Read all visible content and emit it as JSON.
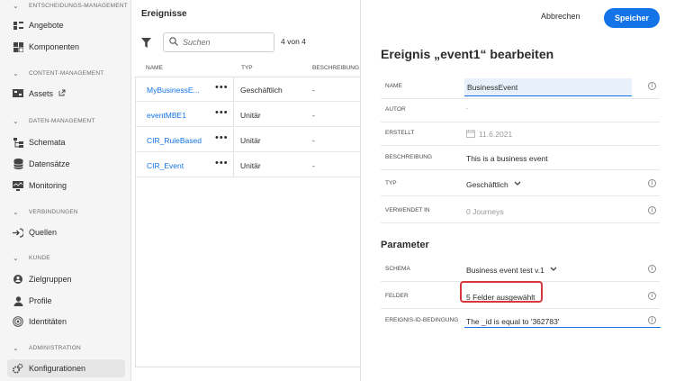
{
  "sidebar": {
    "sections": [
      {
        "label": "ENTSCHEIDUNGS-MANAGEMENT"
      },
      {
        "label": "CONTENT-MANAGEMENT"
      },
      {
        "label": "DATEN-MANAGEMENT"
      },
      {
        "label": "VERBINDUNGEN"
      },
      {
        "label": "KUNDE"
      },
      {
        "label": "ADMINISTRATION"
      }
    ],
    "items": [
      {
        "label": "Angebote",
        "icon": "offers-icon"
      },
      {
        "label": "Komponenten",
        "icon": "components-icon"
      },
      {
        "label": "Assets",
        "icon": "assets-icon"
      },
      {
        "label": "Schemata",
        "icon": "schema-icon"
      },
      {
        "label": "Datensätze",
        "icon": "datasets-icon"
      },
      {
        "label": "Monitoring",
        "icon": "monitoring-icon"
      },
      {
        "label": "Quellen",
        "icon": "sources-icon"
      },
      {
        "label": "Zielgruppen",
        "icon": "audiences-icon"
      },
      {
        "label": "Profile",
        "icon": "profile-icon"
      },
      {
        "label": "Identitäten",
        "icon": "identity-icon"
      },
      {
        "label": "Konfigurationen",
        "icon": "gears-icon"
      }
    ]
  },
  "events": {
    "title": "Ereignisse",
    "search_placeholder": "Suchen",
    "count": "4 von 4",
    "columns": {
      "name": "NAME",
      "type": "TYP",
      "description": "BESCHREIBUNG"
    },
    "rows": [
      {
        "name": "MyBusinessE...",
        "type": "Geschäftlich",
        "description": "-"
      },
      {
        "name": "eventMBE1",
        "type": "Unitär",
        "description": "-"
      },
      {
        "name": "CIR_RuleBased",
        "type": "Unitär",
        "description": "-"
      },
      {
        "name": "CIR_Event",
        "type": "Unitär",
        "description": "-"
      }
    ]
  },
  "editor": {
    "cancel_label": "Abbrechen",
    "save_label": "Speicher",
    "title": "Ereignis „event1“ bearbeiten",
    "fields": {
      "name": {
        "label": "NAME",
        "value": "BusinessEvent"
      },
      "author": {
        "label": "AUTOR",
        "value": "-"
      },
      "created": {
        "label": "ERSTELLT",
        "value": "11.6.2021"
      },
      "description": {
        "label": "BESCHREIBUNG",
        "value": "This is a business event"
      },
      "type": {
        "label": "TYP",
        "value": "Geschäftlich"
      },
      "used_in": {
        "label": "VERWENDET IN",
        "value": "0 Journeys"
      }
    },
    "parameters": {
      "title": "Parameter",
      "schema": {
        "label": "SCHEMA",
        "value": "Business event test v.1"
      },
      "fields": {
        "label": "FELDER",
        "value": "5 Felder ausgewählt"
      },
      "condition": {
        "label": "EREIGNIS-ID-BEDINGUNG",
        "value": "The _id is equal to '362783'"
      }
    },
    "info_glyph": "i"
  },
  "colors": {
    "accent": "#1473e6",
    "highlight": "#d7373f"
  }
}
